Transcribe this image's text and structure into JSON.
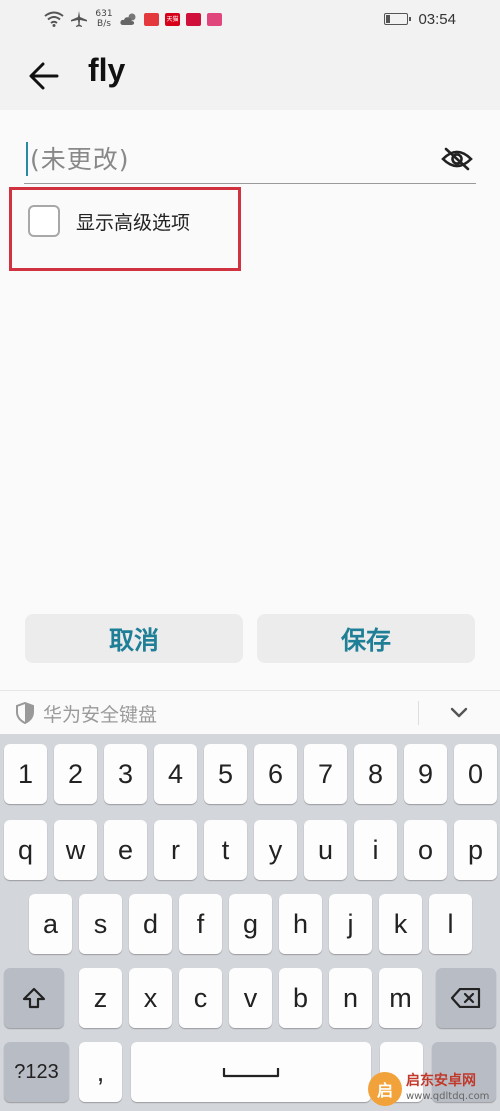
{
  "status_bar": {
    "net_speed_value": "631",
    "net_speed_unit": "B/s",
    "time": "03:54",
    "apps": [
      {
        "name": "app-icon-1",
        "label": "",
        "color": "#e4393c"
      },
      {
        "name": "app-icon-tmall",
        "label": "天猫",
        "color": "#d7001b"
      },
      {
        "name": "app-icon-3",
        "label": "",
        "color": "#d0103a"
      },
      {
        "name": "app-icon-4",
        "label": "",
        "color": "#e0457b"
      }
    ]
  },
  "header": {
    "title": "fly"
  },
  "form": {
    "password_placeholder": "(未更改)",
    "advanced_options_label": "显示高级选项",
    "advanced_options_checked": false,
    "cancel_label": "取消",
    "save_label": "保存"
  },
  "keyboard": {
    "title": "华为安全键盘",
    "row_numbers": [
      "1",
      "2",
      "3",
      "4",
      "5",
      "6",
      "7",
      "8",
      "9",
      "0"
    ],
    "row_top": [
      "q",
      "w",
      "e",
      "r",
      "t",
      "y",
      "u",
      "i",
      "o",
      "p"
    ],
    "row_home": [
      "a",
      "s",
      "d",
      "f",
      "g",
      "h",
      "j",
      "k",
      "l"
    ],
    "row_bottom": [
      "z",
      "x",
      "c",
      "v",
      "b",
      "n",
      "m"
    ],
    "symbols_label": "?123",
    "comma_label": ","
  },
  "watermark": {
    "name": "启东安卓网",
    "url": "www.qdltdq.com"
  },
  "colors": {
    "accent": "#1f7f96",
    "highlight": "#d0333f",
    "keyboard_bg": "#d3d6db"
  }
}
